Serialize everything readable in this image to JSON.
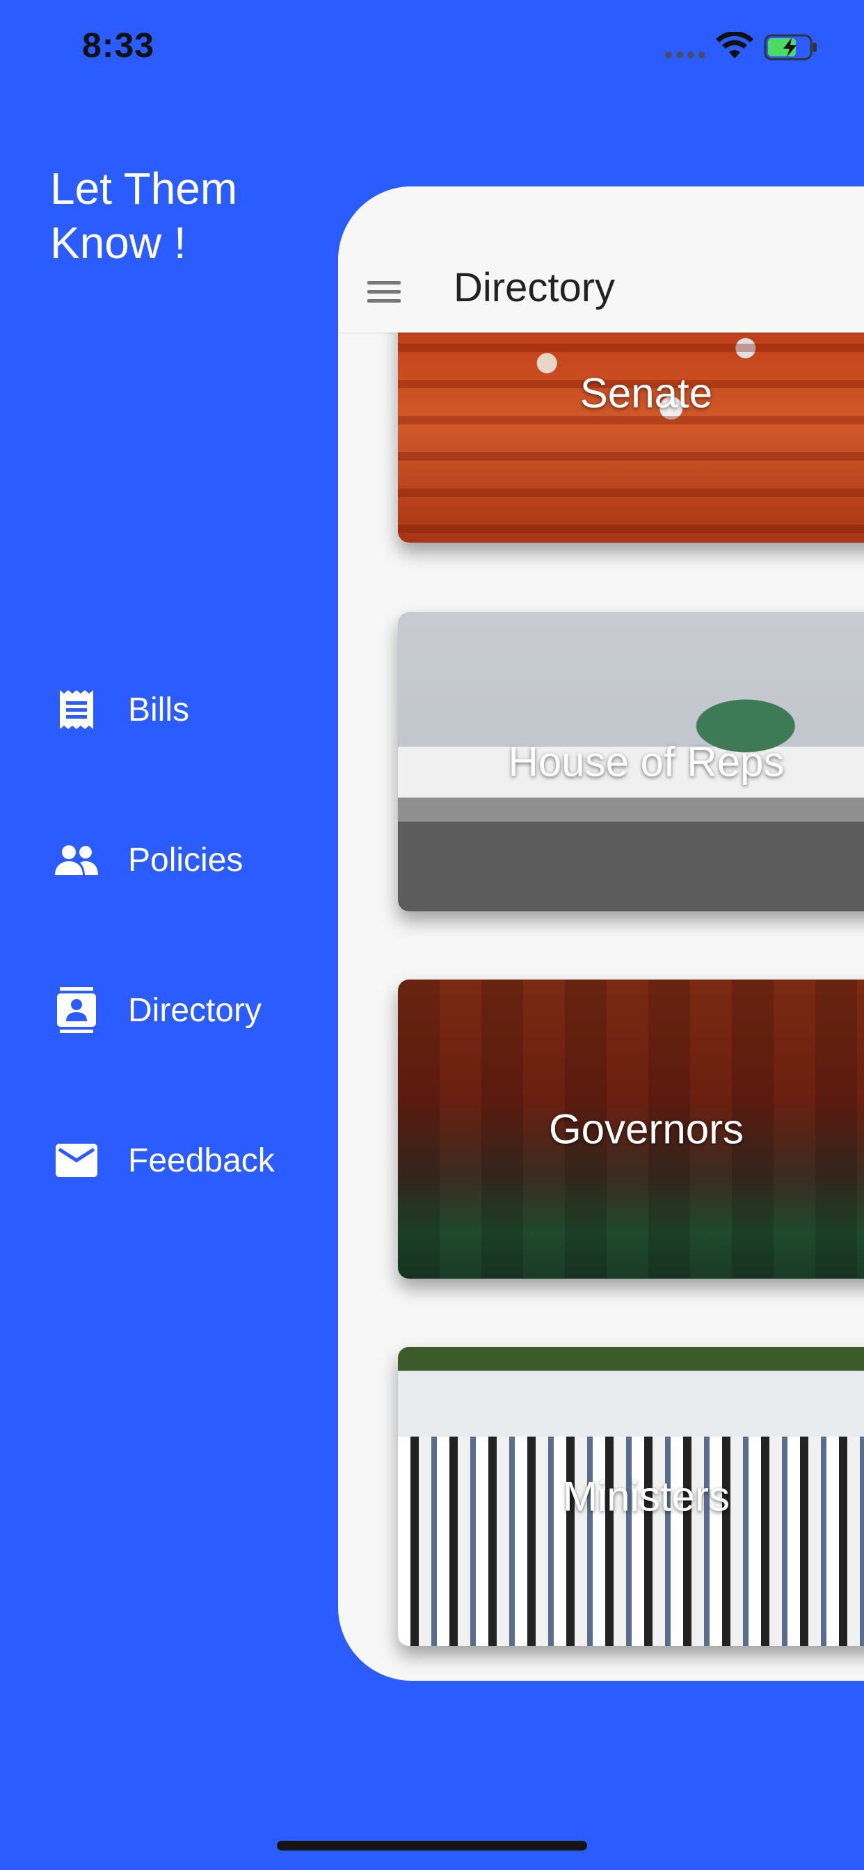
{
  "status_bar": {
    "time": "8:33"
  },
  "drawer": {
    "app_title": "Let Them\nKnow !",
    "items": [
      {
        "label": "Bills",
        "icon": "receipt-icon"
      },
      {
        "label": "Policies",
        "icon": "people-icon"
      },
      {
        "label": "Directory",
        "icon": "contacts-icon"
      },
      {
        "label": "Feedback",
        "icon": "mail-icon"
      }
    ]
  },
  "app_bar": {
    "title": "Directory",
    "menu_icon": "hamburger-icon"
  },
  "cards": [
    {
      "label": "Senate"
    },
    {
      "label": "House of Reps"
    },
    {
      "label": "Governors"
    },
    {
      "label": "Ministers"
    }
  ],
  "colors": {
    "drawer_background": "#2a5cff",
    "panel_background": "#f7f7f7",
    "text_on_drawer": "#ffffff",
    "app_bar_title": "#222222"
  }
}
